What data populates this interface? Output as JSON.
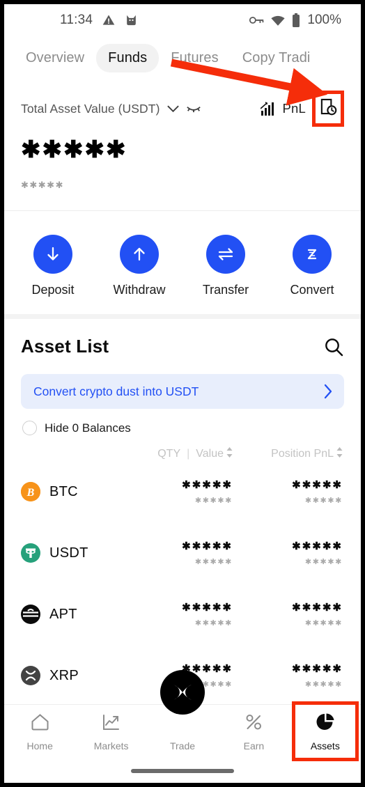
{
  "status_bar": {
    "time": "11:34",
    "battery_percent": "100%",
    "icons": [
      "warning-triangle-icon",
      "cat-app-icon",
      "vpn-key-icon",
      "wifi-icon",
      "battery-icon"
    ]
  },
  "tabs": [
    {
      "label": "Overview",
      "active": false
    },
    {
      "label": "Funds",
      "active": true
    },
    {
      "label": "Futures",
      "active": false
    },
    {
      "label": "Copy Tradi",
      "active": false
    }
  ],
  "balance": {
    "label": "Total Asset Value (USDT)",
    "amount_masked": "✱✱✱✱✱",
    "sub_masked": "✱✱✱✱✱",
    "pnl_label": "PnL"
  },
  "quick_actions": [
    {
      "label": "Deposit",
      "icon": "arrow-down-icon"
    },
    {
      "label": "Withdraw",
      "icon": "arrow-up-icon"
    },
    {
      "label": "Transfer",
      "icon": "transfer-arrows-icon"
    },
    {
      "label": "Convert",
      "icon": "convert-icon"
    }
  ],
  "asset_list": {
    "title": "Asset List",
    "dust_banner": "Convert crypto dust into USDT",
    "hide_zero_label": "Hide 0 Balances",
    "columns": {
      "qty": "QTY",
      "separator": "|",
      "value": "Value",
      "position_pnl": "Position PnL"
    },
    "rows": [
      {
        "symbol": "BTC",
        "icon_glyph": "Ƀ",
        "icon_color": "#f7931a",
        "qty_masked": "✱✱✱✱✱",
        "value_masked": "✱✱✱✱✱",
        "pnl_masked": "✱✱✱✱✱",
        "pnl_sub_masked": "✱✱✱✱✱"
      },
      {
        "symbol": "USDT",
        "icon_glyph": "₮",
        "icon_color": "#26a17b",
        "qty_masked": "✱✱✱✱✱",
        "value_masked": "✱✱✱✱✱",
        "pnl_masked": "✱✱✱✱✱",
        "pnl_sub_masked": "✱✱✱✱✱"
      },
      {
        "symbol": "APT",
        "icon_glyph": "≡",
        "icon_color": "#0b0b0b",
        "qty_masked": "✱✱✱✱✱",
        "value_masked": "✱✱✱✱✱",
        "pnl_masked": "✱✱✱✱✱",
        "pnl_sub_masked": "✱✱✱✱✱"
      },
      {
        "symbol": "XRP",
        "icon_glyph": "✕",
        "icon_color": "#434343",
        "qty_masked": "✱✱✱✱✱",
        "value_masked": "✱✱✱✱✱",
        "pnl_masked": "✱✱✱✱✱",
        "pnl_sub_masked": "✱✱✱✱✱"
      }
    ]
  },
  "bottom_nav": [
    {
      "label": "Home",
      "icon": "home-icon",
      "active": false
    },
    {
      "label": "Markets",
      "icon": "chart-line-icon",
      "active": false
    },
    {
      "label": "Trade",
      "icon": "trade-x-logo-icon",
      "active": false
    },
    {
      "label": "Earn",
      "icon": "percent-icon",
      "active": false
    },
    {
      "label": "Assets",
      "icon": "pie-chart-icon",
      "active": true
    }
  ],
  "annotations": {
    "highlight_color": "#f52d0a",
    "arrow_from": "Funds tab",
    "arrow_to": "transaction-history-icon",
    "highlighted_elements": [
      "transaction-history-icon",
      "nav-item-assets"
    ]
  },
  "colors": {
    "accent_blue": "#2250f4",
    "banner_bg": "#e8eefc",
    "active_tab_bg": "#f2f2f2"
  }
}
